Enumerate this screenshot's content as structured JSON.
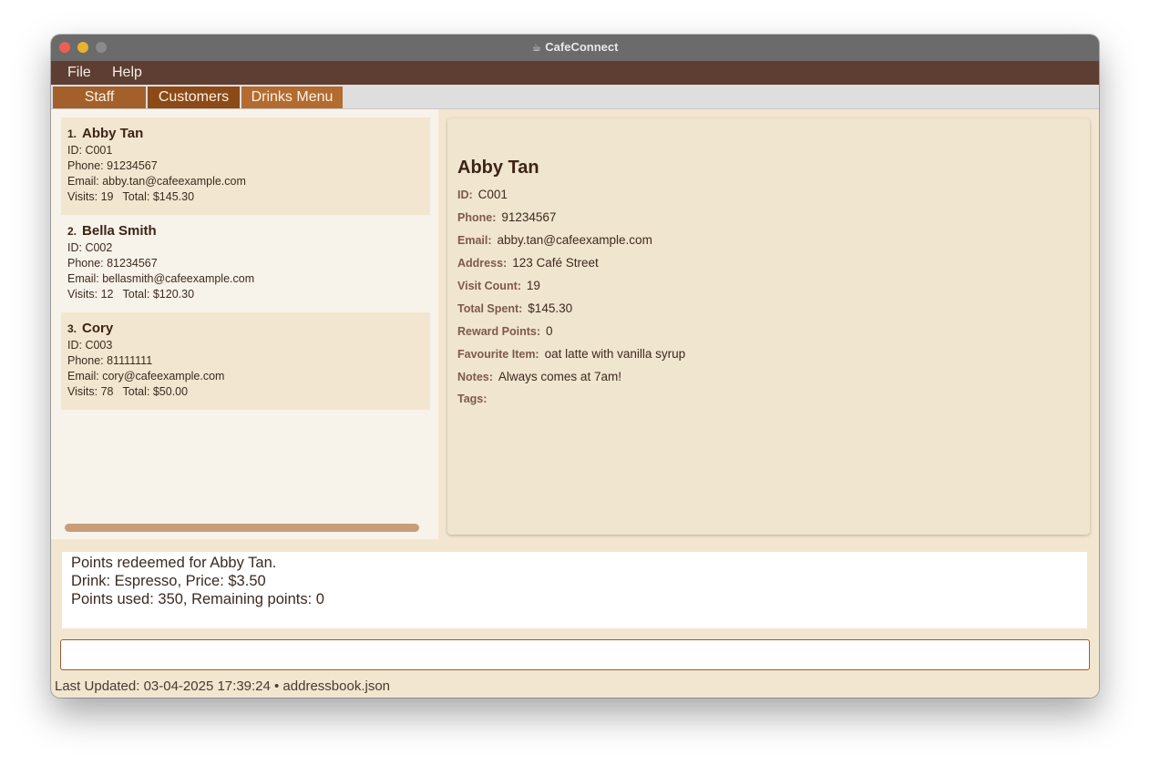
{
  "window": {
    "title": "CafeConnect",
    "title_icon": "coffee-cup-icon"
  },
  "menu": {
    "items": [
      {
        "label": "File"
      },
      {
        "label": "Help"
      }
    ]
  },
  "tabs": [
    {
      "label": "Staff"
    },
    {
      "label": "Customers",
      "selected": true
    },
    {
      "label": "Drinks Menu"
    }
  ],
  "customers": [
    {
      "index": "1.",
      "name": "Abby Tan",
      "id": "ID: C001",
      "phone": "Phone: 91234567",
      "email": "Email: abby.tan@cafeexample.com",
      "visits": "Visits: 19",
      "total": "Total: $145.30"
    },
    {
      "index": "2.",
      "name": "Bella Smith",
      "id": "ID: C002",
      "phone": "Phone: 81234567",
      "email": "Email: bellasmith@cafeexample.com",
      "visits": "Visits: 12",
      "total": "Total: $120.30"
    },
    {
      "index": "3.",
      "name": "Cory",
      "id": "ID: C003",
      "phone": "Phone: 81111111",
      "email": "Email: cory@cafeexample.com",
      "visits": "Visits: 78",
      "total": "Total: $50.00"
    }
  ],
  "detail": {
    "name": "Abby Tan",
    "fields": [
      {
        "label": "ID:",
        "value": "C001"
      },
      {
        "label": "Phone:",
        "value": "91234567"
      },
      {
        "label": "Email:",
        "value": "abby.tan@cafeexample.com"
      },
      {
        "label": "Address:",
        "value": "123 Café Street"
      },
      {
        "label": "Visit Count:",
        "value": "19"
      },
      {
        "label": "Total Spent:",
        "value": "$145.30"
      },
      {
        "label": "Reward Points:",
        "value": "0"
      },
      {
        "label": "Favourite Item:",
        "value": "oat latte with vanilla syrup"
      },
      {
        "label": "Notes:",
        "value": "Always comes at 7am!"
      },
      {
        "label": "Tags:",
        "value": ""
      }
    ]
  },
  "result": {
    "lines": [
      "Points redeemed for Abby Tan.",
      "Drink: Espresso, Price: $3.50",
      "Points used: 350, Remaining points: 0"
    ]
  },
  "command": {
    "value": "",
    "placeholder": ""
  },
  "status": {
    "text": "Last Updated: 03-04-2025 17:39:24 • addressbook.json"
  },
  "colors": {
    "menubar": "#5e3e32",
    "tab_selected": "#8c4a17",
    "panel": "#f0e5cf"
  }
}
